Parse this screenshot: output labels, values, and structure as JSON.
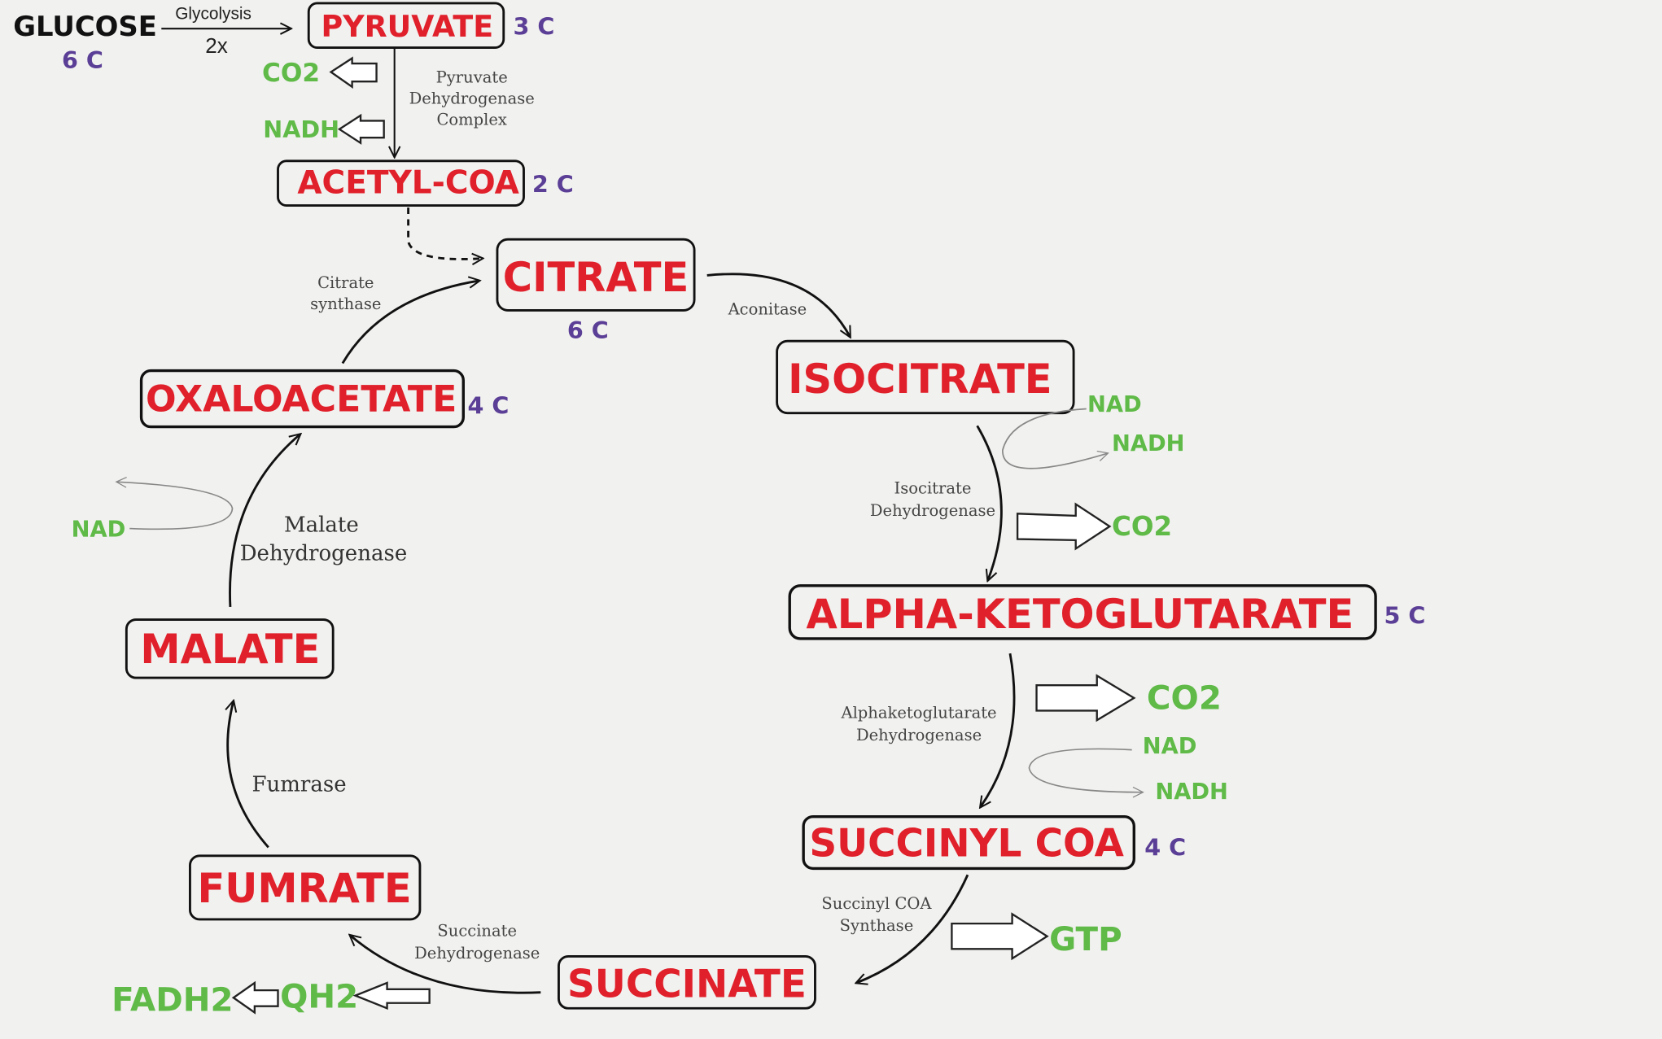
{
  "colors": {
    "molecule": "#e0202a",
    "carbon_count": "#5b3e96",
    "cofactor": "#5fba47",
    "background": "#f1f1ef"
  },
  "start": {
    "glucose": "GLUCOSE",
    "glucose_carbons": "6 C",
    "glycolysis": "Glycolysis",
    "multiplier": "2x"
  },
  "molecules": {
    "pyruvate": {
      "name": "PYRUVATE",
      "carbons": "3 C"
    },
    "acetyl_coa": {
      "name": "ACETYL-COA",
      "carbons": "2 C"
    },
    "citrate": {
      "name": "CITRATE",
      "carbons": "6 C"
    },
    "isocitrate": {
      "name": "ISOCITRATE"
    },
    "alpha_ketoglutarate": {
      "name": "ALPHA-KETOGLUTARATE",
      "carbons": "5 C"
    },
    "succinyl_coa": {
      "name": "SUCCINYL COA",
      "carbons": "4 C"
    },
    "succinate": {
      "name": "SUCCINATE"
    },
    "fumarate": {
      "name": "FUMRATE"
    },
    "malate": {
      "name": "MALATE"
    },
    "oxaloacetate": {
      "name": "OXALOACETATE",
      "carbons": "4 C"
    }
  },
  "enzymes": {
    "pdc": [
      "Pyruvate",
      "Dehydrogenase",
      "Complex"
    ],
    "citrate_synthase": [
      "Citrate",
      "synthase"
    ],
    "aconitase": "Aconitase",
    "idh": [
      "Isocitrate",
      "Dehydrogenase"
    ],
    "akgdh": [
      "Alphaketoglutarate",
      "Dehydrogenase"
    ],
    "scs": [
      "Succinyl COA",
      "Synthase"
    ],
    "sdh": [
      "Succinate",
      "Dehydrogenase"
    ],
    "fumarase": "Fumrase",
    "mdh": [
      "Malate",
      "Dehydrogenase"
    ]
  },
  "cofactors": {
    "pdc_co2": "CO2",
    "pdc_nadh": "NADH",
    "idh_nad": "NAD",
    "idh_nadh": "NADH",
    "idh_co2": "CO2",
    "akg_co2": "CO2",
    "akg_nad": "NAD",
    "akg_nadh": "NADH",
    "gtp": "GTP",
    "qh2": "QH2",
    "fadh2": "FADH2",
    "mdh_nad": "NAD"
  }
}
